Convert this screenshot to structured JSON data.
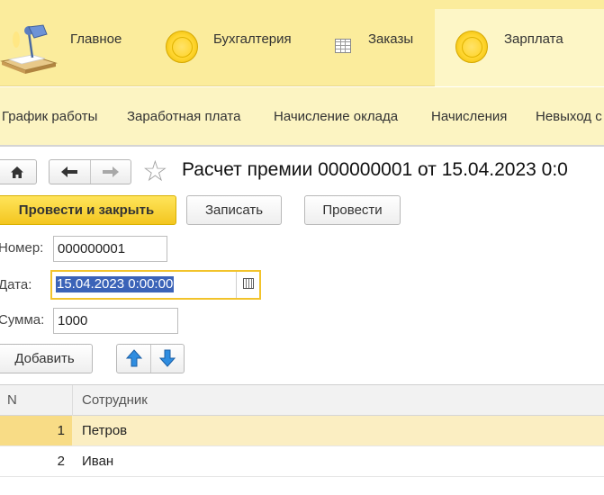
{
  "sections": {
    "items": [
      {
        "label": "Главное",
        "icon": "desk-lamp-icon"
      },
      {
        "label": "Бухгалтерия",
        "icon": "coin-icon"
      },
      {
        "label": "Заказы",
        "icon": "table-icon"
      },
      {
        "label": "Зарплата",
        "icon": "coin-icon",
        "active": true
      }
    ]
  },
  "subnav": {
    "items": [
      "График работы",
      "Заработная плата",
      "Начисление оклада",
      "Начисления",
      "Невыход с"
    ]
  },
  "form": {
    "title": "Расчет премии 000000001 от 15.04.2023 0:0",
    "commands": {
      "post_close": "Провести и закрыть",
      "save": "Записать",
      "post": "Провести"
    },
    "fields": {
      "number_label": "Номер:",
      "number_value": "000000001",
      "date_label": "Дата:",
      "date_value": "15.04.2023  0:00:00",
      "sum_label": "Сумма:",
      "sum_value": "1000"
    }
  },
  "table": {
    "add_label": "Добавить",
    "columns": [
      "N",
      "Сотрудник"
    ],
    "rows": [
      {
        "n": "1",
        "employee": "Петров",
        "selected": true
      },
      {
        "n": "2",
        "employee": "Иван",
        "selected": false
      }
    ]
  },
  "colors": {
    "sections_bg": "#fbec9c",
    "subnav_bg": "#fcf4c2",
    "primary_button": "#f3c620",
    "focus_border": "#f2c32b",
    "selected_row": "#fbeec2"
  }
}
